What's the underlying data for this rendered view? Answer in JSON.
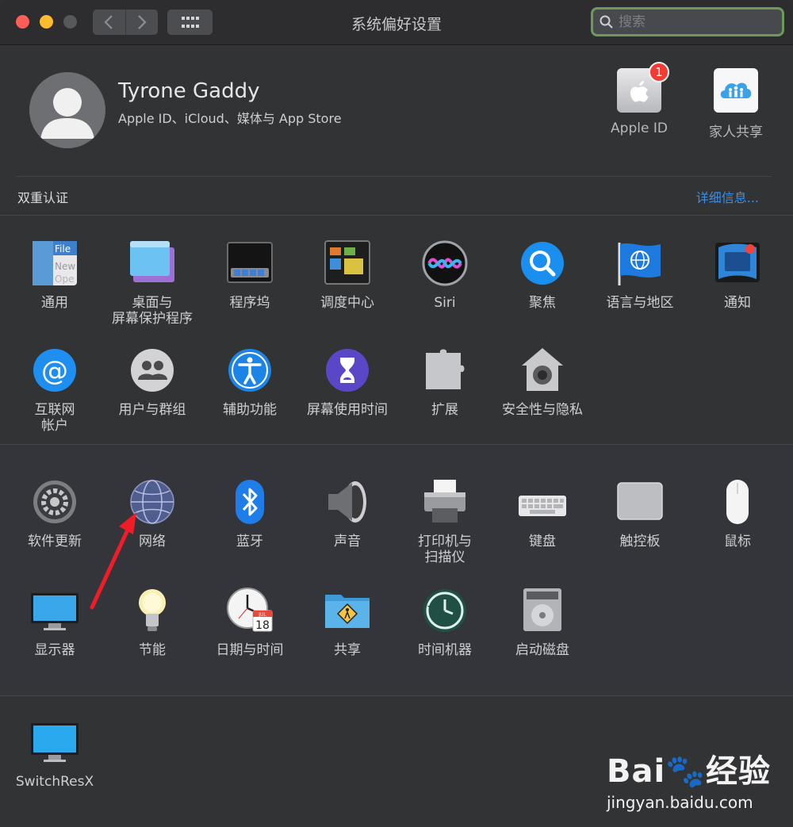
{
  "window": {
    "title": "系统偏好设置"
  },
  "search": {
    "placeholder": "搜索"
  },
  "account": {
    "name": "Tyrone Gaddy",
    "subtitle": "Apple ID、iCloud、媒体与 App Store",
    "apple_id_label": "Apple ID",
    "apple_id_badge": "1",
    "family_label": "家人共享"
  },
  "notice": {
    "label": "双重认证",
    "link": "详细信息..."
  },
  "row1": [
    {
      "label": "通用",
      "icon": "general-icon"
    },
    {
      "label": "桌面与\n屏幕保护程序",
      "icon": "desktop-icon"
    },
    {
      "label": "程序坞",
      "icon": "dock-icon"
    },
    {
      "label": "调度中心",
      "icon": "mission-control-icon"
    },
    {
      "label": "Siri",
      "icon": "siri-icon"
    },
    {
      "label": "聚焦",
      "icon": "spotlight-icon"
    },
    {
      "label": "语言与地区",
      "icon": "language-region-icon"
    },
    {
      "label": "通知",
      "icon": "notifications-icon"
    }
  ],
  "row2": [
    {
      "label": "互联网\n帐户",
      "icon": "internet-accounts-icon"
    },
    {
      "label": "用户与群组",
      "icon": "users-groups-icon"
    },
    {
      "label": "辅助功能",
      "icon": "accessibility-icon"
    },
    {
      "label": "屏幕使用时间",
      "icon": "screen-time-icon"
    },
    {
      "label": "扩展",
      "icon": "extensions-icon"
    },
    {
      "label": "安全性与隐私",
      "icon": "security-privacy-icon"
    }
  ],
  "row3": [
    {
      "label": "软件更新",
      "icon": "software-update-icon"
    },
    {
      "label": "网络",
      "icon": "network-icon"
    },
    {
      "label": "蓝牙",
      "icon": "bluetooth-icon"
    },
    {
      "label": "声音",
      "icon": "sound-icon"
    },
    {
      "label": "打印机与\n扫描仪",
      "icon": "printer-icon"
    },
    {
      "label": "键盘",
      "icon": "keyboard-icon"
    },
    {
      "label": "触控板",
      "icon": "trackpad-icon"
    },
    {
      "label": "鼠标",
      "icon": "mouse-icon"
    }
  ],
  "row4": [
    {
      "label": "显示器",
      "icon": "displays-icon"
    },
    {
      "label": "节能",
      "icon": "energy-saver-icon"
    },
    {
      "label": "日期与时间",
      "icon": "date-time-icon"
    },
    {
      "label": "共享",
      "icon": "sharing-icon"
    },
    {
      "label": "时间机器",
      "icon": "time-machine-icon"
    },
    {
      "label": "启动磁盘",
      "icon": "startup-disk-icon"
    }
  ],
  "other": [
    {
      "label": "SwitchResX",
      "icon": "switchresx-icon"
    }
  ],
  "calendar_icon": {
    "month": "JUL",
    "day": "18"
  },
  "watermark": {
    "logo": "Bai🐾经验",
    "url": "jingyan.baidu.com"
  }
}
